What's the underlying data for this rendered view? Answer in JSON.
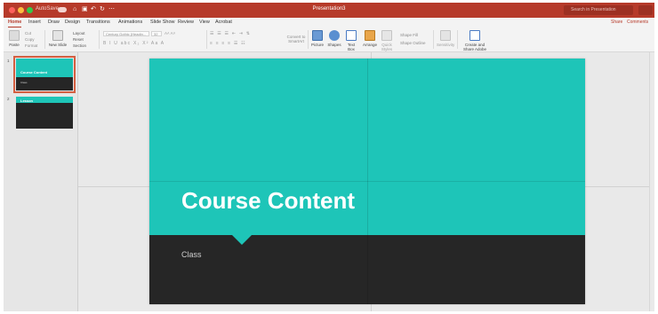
{
  "window": {
    "title": "Presentation3",
    "autosave_label": "AutoSave",
    "search_placeholder": "Search in Presentation"
  },
  "quick_access": [
    "home-icon",
    "save-icon",
    "undo-icon",
    "redo-icon",
    "more-icon"
  ],
  "ribbon_tabs": [
    {
      "label": "Home",
      "active": true
    },
    {
      "label": "Insert",
      "active": false
    },
    {
      "label": "Draw",
      "active": false
    },
    {
      "label": "Design",
      "active": false
    },
    {
      "label": "Transitions",
      "active": false
    },
    {
      "label": "Animations",
      "active": false
    },
    {
      "label": "Slide Show",
      "active": false
    },
    {
      "label": "Review",
      "active": false
    },
    {
      "label": "View",
      "active": false
    },
    {
      "label": "Acrobat",
      "active": false
    }
  ],
  "toolbar": {
    "share_label": "Share",
    "comments_label": "Comments",
    "paste_label": "Paste",
    "cut_label": "Cut",
    "copy_label": "Copy",
    "format_label": "Format",
    "new_slide_label": "New Slide",
    "layout_label": "Layout",
    "reset_label": "Reset",
    "section_label": "Section",
    "font_name": "Century Gothic (Headin...",
    "font_size": "32",
    "convert_label": "Convert to SmartArt",
    "picture_label": "Picture",
    "shapes_label": "Shapes",
    "text_box_label": "Text Box",
    "arrange_label": "Arrange",
    "quick_styles_label": "Quick Styles",
    "shape_fill_label": "Shape Fill",
    "shape_outline_label": "Shape Outline",
    "sensitivity_label": "Sensitivity",
    "create_pdf_label": "Create and Share Adobe PDF"
  },
  "slides": [
    {
      "number": "1",
      "title": "Course Content",
      "subtitle": "Class",
      "selected": true
    },
    {
      "number": "2",
      "title": "Lesson",
      "subtitle": "",
      "selected": false
    }
  ],
  "current_slide": {
    "title": "Course Content",
    "subtitle": "Class"
  },
  "colors": {
    "title_bar": "#b63a2a",
    "slide_accent": "#1ec5b8",
    "slide_dark": "#262626",
    "selection": "#d45f41"
  }
}
